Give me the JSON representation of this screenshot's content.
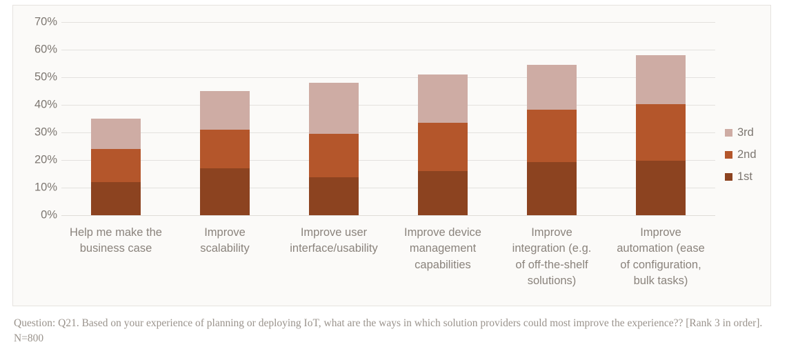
{
  "chart_data": {
    "type": "bar",
    "stacked": true,
    "title": "",
    "xlabel": "",
    "ylabel": "",
    "ylim": [
      0,
      70
    ],
    "ytick_labels": [
      "0%",
      "10%",
      "20%",
      "30%",
      "40%",
      "50%",
      "60%",
      "70%"
    ],
    "ytick_values": [
      0,
      10,
      20,
      30,
      40,
      50,
      60,
      70
    ],
    "grid": true,
    "legend_position": "right",
    "categories": [
      "Help me make the\nbusiness case",
      "Improve\nscalability",
      "Improve user\ninterface/usability",
      "Improve device\nmanagement\ncapabilities",
      "Improve\nintegration (e.g.\nof off-the-shelf\nsolutions)",
      "Improve\nautomation (ease\nof configuration,\nbulk tasks)"
    ],
    "series": [
      {
        "name": "1st",
        "color": "#8C4320",
        "values": [
          12.0,
          17.0,
          13.8,
          16.0,
          19.3,
          19.8
        ]
      },
      {
        "name": "2nd",
        "color": "#B4562B",
        "values": [
          12.0,
          14.0,
          15.7,
          17.5,
          18.9,
          20.4
        ]
      },
      {
        "name": "3rd",
        "color": "#CEACA4",
        "values": [
          11.0,
          14.0,
          18.5,
          17.5,
          16.3,
          17.8
        ]
      }
    ],
    "series_order_bottom_to_top": [
      "1st",
      "2nd",
      "3rd"
    ],
    "totals": [
      35.0,
      45.0,
      48.0,
      51.0,
      54.5,
      58.0
    ],
    "cumulative": [
      {
        "category": "Help me make the business case",
        "1st": 12.0,
        "1st+2nd": 24.0,
        "total": 35.0
      },
      {
        "category": "Improve scalability",
        "1st": 17.0,
        "1st+2nd": 31.0,
        "total": 45.0
      },
      {
        "category": "Improve user interface/usability",
        "1st": 13.8,
        "1st+2nd": 29.5,
        "total": 48.0
      },
      {
        "category": "Improve device management capabilities",
        "1st": 16.0,
        "1st+2nd": 33.5,
        "total": 51.0
      },
      {
        "category": "Improve integration (e.g. of off-the-shelf solutions)",
        "1st": 19.3,
        "1st+2nd": 38.2,
        "total": 54.5
      },
      {
        "category": "Improve automation (ease of configuration, bulk tasks)",
        "1st": 19.8,
        "1st+2nd": 40.2,
        "total": 58.0
      }
    ]
  },
  "legend": {
    "entries": [
      {
        "label": "3rd",
        "color": "#CEACA4"
      },
      {
        "label": "2nd",
        "color": "#B4562B"
      },
      {
        "label": "1st",
        "color": "#8C4320"
      }
    ]
  },
  "footnote": {
    "text": "Question: Q21. Based on your experience of planning or deploying IoT, what are the ways in which solution providers could most improve the experience?? [Rank 3 in order]. N=800"
  },
  "style": {
    "plot_background": "#FBFAF8",
    "gridline_color": "#E3E1DE",
    "axis_text_color": "#8A837C",
    "footnote_color": "#9A938C"
  }
}
